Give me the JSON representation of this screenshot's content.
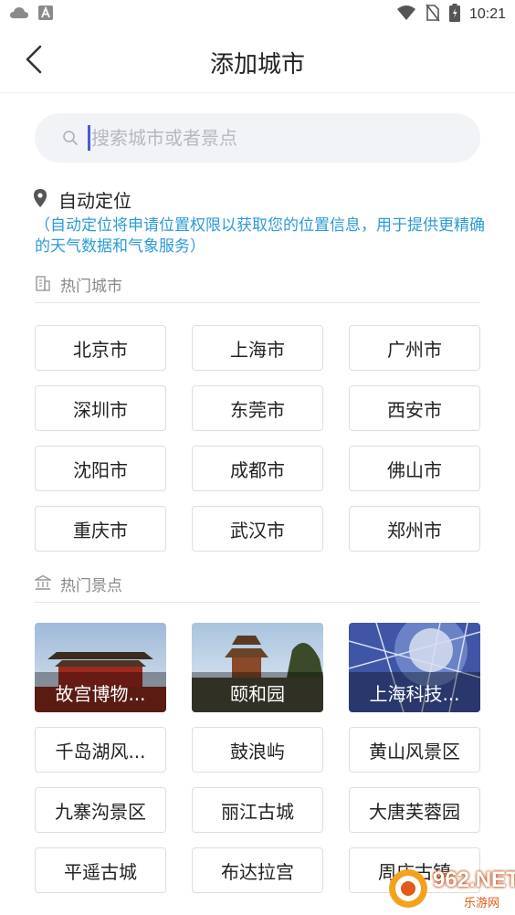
{
  "status_bar": {
    "time": "10:21",
    "left_icons": [
      "cloud-icon",
      "a-badge-icon"
    ],
    "right_icons": [
      "wifi-icon",
      "no-sim-icon",
      "battery-icon"
    ]
  },
  "header": {
    "title": "添加城市",
    "back_icon": "chevron-left-icon"
  },
  "search": {
    "placeholder": "搜索城市或者景点",
    "value": ""
  },
  "auto_location": {
    "label": "自动定位",
    "note": "（自动定位将申请位置权限以获取您的位置信息，用于提供更精确的天气数据和气象服务）"
  },
  "hot_cities": {
    "title": "热门城市",
    "items": [
      "北京市",
      "上海市",
      "广州市",
      "深圳市",
      "东莞市",
      "西安市",
      "沈阳市",
      "成都市",
      "佛山市",
      "重庆市",
      "武汉市",
      "郑州市"
    ]
  },
  "hot_spots": {
    "title": "热门景点",
    "featured": [
      {
        "label": "故宫博物..."
      },
      {
        "label": "颐和园"
      },
      {
        "label": "上海科技..."
      }
    ],
    "items": [
      "千岛湖风...",
      "鼓浪屿",
      "黄山风景区",
      "九寨沟景区",
      "丽江古城",
      "大唐芙蓉园",
      "平遥古城",
      "布达拉宫",
      "周庄古镇"
    ]
  },
  "watermark": {
    "text": "962.NET",
    "sub": "乐游网"
  },
  "colors": {
    "accent_note": "#2b9bd8",
    "cursor": "#4b5bd6",
    "search_bg": "#f1f3f6",
    "border": "#dedede"
  }
}
